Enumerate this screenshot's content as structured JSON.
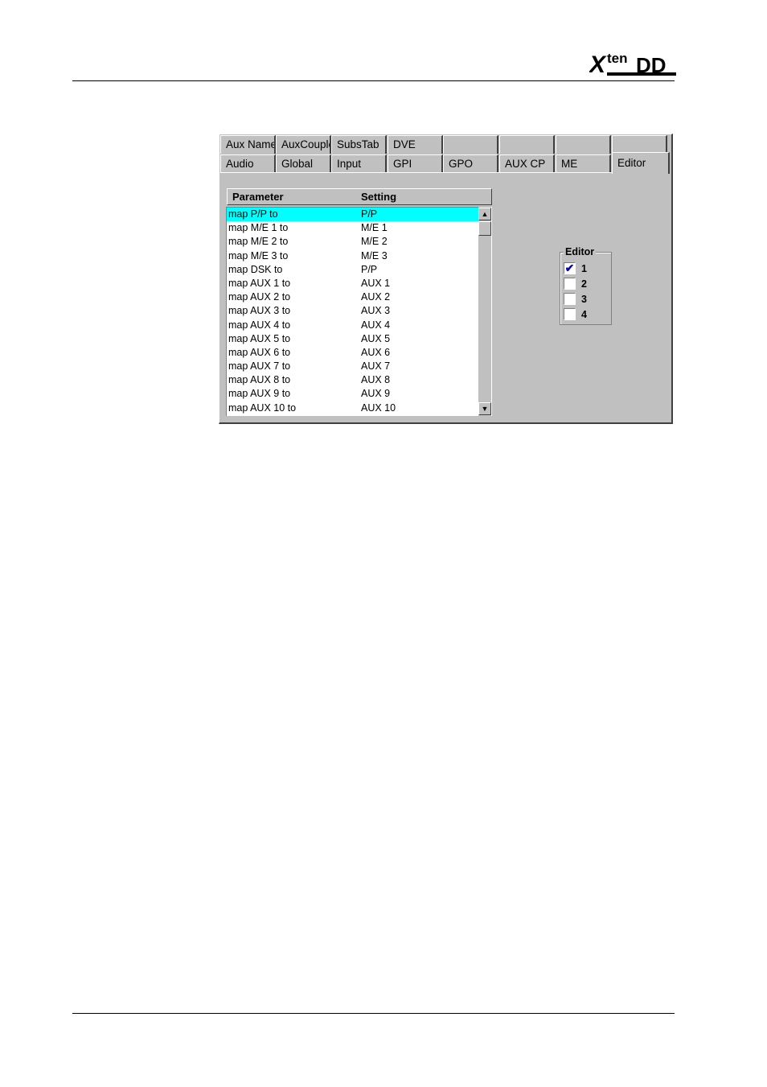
{
  "logo": {
    "text": "Xten DD",
    "brand_color": "#000000"
  },
  "tabs_row1": [
    "Aux Name",
    "AuxCouple",
    "SubsTab",
    "DVE",
    "",
    "",
    "",
    ""
  ],
  "tabs_row2": [
    "Audio",
    "Global",
    "Input",
    "GPI",
    "GPO",
    "AUX CP",
    "ME",
    "Editor"
  ],
  "active_tab": "Editor",
  "table": {
    "headers": {
      "parameter": "Parameter",
      "setting": "Setting"
    },
    "rows": [
      {
        "parameter": "map P/P to",
        "setting": "P/P"
      },
      {
        "parameter": "map M/E 1 to",
        "setting": "M/E 1"
      },
      {
        "parameter": "map M/E 2 to",
        "setting": "M/E 2"
      },
      {
        "parameter": "map M/E 3 to",
        "setting": "M/E 3"
      },
      {
        "parameter": "map DSK to",
        "setting": "P/P"
      },
      {
        "parameter": "map AUX 1 to",
        "setting": "AUX 1"
      },
      {
        "parameter": "map AUX 2 to",
        "setting": "AUX 2"
      },
      {
        "parameter": "map AUX 3 to",
        "setting": "AUX 3"
      },
      {
        "parameter": "map AUX 4 to",
        "setting": "AUX 4"
      },
      {
        "parameter": "map AUX 5 to",
        "setting": "AUX 5"
      },
      {
        "parameter": "map AUX 6 to",
        "setting": "AUX 6"
      },
      {
        "parameter": "map AUX 7 to",
        "setting": "AUX 7"
      },
      {
        "parameter": "map AUX 8 to",
        "setting": "AUX 8"
      },
      {
        "parameter": "map AUX 9 to",
        "setting": "AUX 9"
      },
      {
        "parameter": "map AUX 10 to",
        "setting": "AUX 10"
      }
    ],
    "selected_index": 0,
    "selected_color": "#00ffff"
  },
  "editor_group": {
    "title": "Editor",
    "options": [
      {
        "label": "1",
        "checked": true
      },
      {
        "label": "2",
        "checked": false
      },
      {
        "label": "3",
        "checked": false
      },
      {
        "label": "4",
        "checked": false
      }
    ]
  }
}
